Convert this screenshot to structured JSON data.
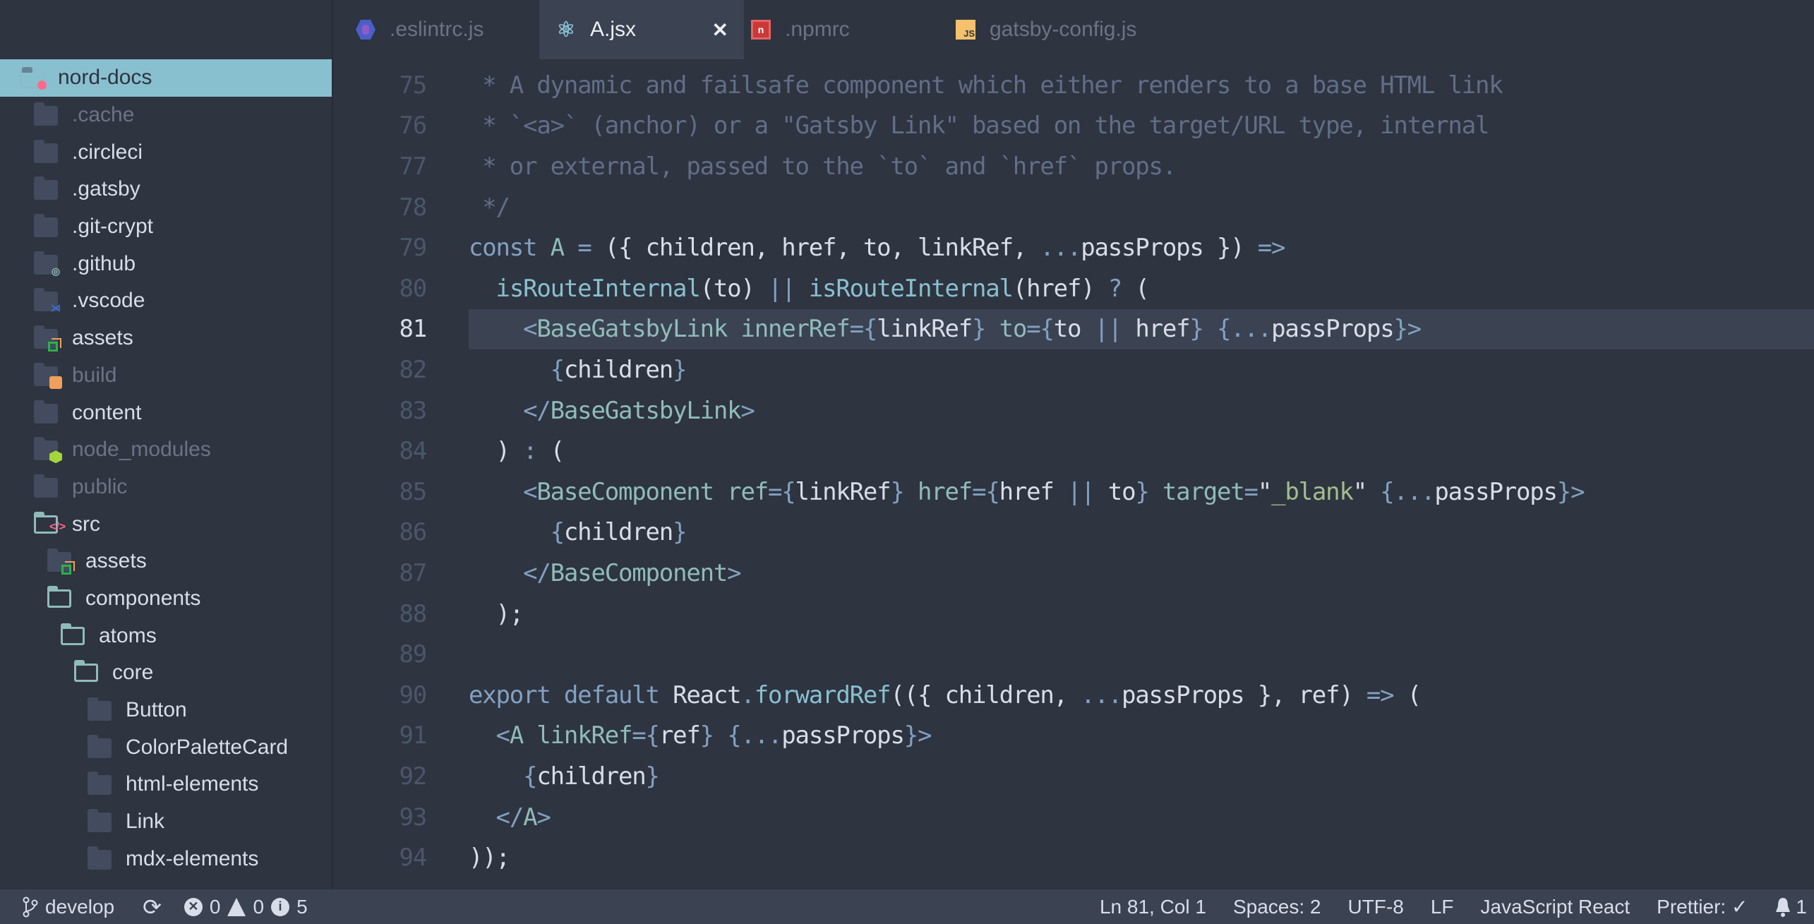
{
  "sidebar": {
    "items": [
      {
        "label": "nord-docs",
        "icon": "folder-root-icon",
        "depth": 0,
        "dim": false,
        "open": false,
        "selected": true
      },
      {
        "label": ".cache",
        "icon": "folder-icon",
        "depth": 1,
        "dim": true
      },
      {
        "label": ".circleci",
        "icon": "folder-icon",
        "depth": 1,
        "dim": false
      },
      {
        "label": ".gatsby",
        "icon": "folder-icon",
        "depth": 1,
        "dim": false
      },
      {
        "label": ".git-crypt",
        "icon": "folder-icon",
        "depth": 1,
        "dim": false
      },
      {
        "label": ".github",
        "icon": "folder-github-icon",
        "depth": 1,
        "dim": false
      },
      {
        "label": ".vscode",
        "icon": "folder-vscode-icon",
        "depth": 1,
        "dim": false
      },
      {
        "label": "assets",
        "icon": "folder-assets-icon",
        "depth": 1,
        "dim": false
      },
      {
        "label": "build",
        "icon": "folder-build-icon",
        "depth": 1,
        "dim": true
      },
      {
        "label": "content",
        "icon": "folder-icon",
        "depth": 1,
        "dim": false
      },
      {
        "label": "node_modules",
        "icon": "folder-node-icon",
        "depth": 1,
        "dim": true
      },
      {
        "label": "public",
        "icon": "folder-icon",
        "depth": 1,
        "dim": true
      },
      {
        "label": "src",
        "icon": "folder-src-open-icon",
        "depth": 1,
        "dim": false,
        "open": true
      },
      {
        "label": "assets",
        "icon": "folder-assets-icon",
        "depth": 2,
        "dim": false
      },
      {
        "label": "components",
        "icon": "folder-open-icon",
        "depth": 2,
        "dim": false,
        "open": true
      },
      {
        "label": "atoms",
        "icon": "folder-open-icon",
        "depth": 3,
        "dim": false,
        "open": true
      },
      {
        "label": "core",
        "icon": "folder-open-icon",
        "depth": 4,
        "dim": false,
        "open": true
      },
      {
        "label": "Button",
        "icon": "folder-icon",
        "depth": 5,
        "dim": false
      },
      {
        "label": "ColorPaletteCard",
        "icon": "folder-icon",
        "depth": 5,
        "dim": false
      },
      {
        "label": "html-elements",
        "icon": "folder-icon",
        "depth": 5,
        "dim": false
      },
      {
        "label": "Link",
        "icon": "folder-icon",
        "depth": 5,
        "dim": false
      },
      {
        "label": "mdx-elements",
        "icon": "folder-icon",
        "depth": 5,
        "dim": false
      }
    ]
  },
  "tabs": [
    {
      "label": ".eslintrc.js",
      "icon": "eslint-icon",
      "active": false
    },
    {
      "label": "A.jsx",
      "icon": "react-icon",
      "active": true
    },
    {
      "label": ".npmrc",
      "icon": "npm-icon",
      "active": false
    },
    {
      "label": "gatsby-config.js",
      "icon": "js-icon",
      "active": false
    }
  ],
  "editor": {
    "current_line": 81,
    "lines": [
      {
        "n": "75",
        "tokens": [
          [
            " * A dynamic and failsafe component which either renders to a base HTML link",
            "comment"
          ]
        ]
      },
      {
        "n": "76",
        "tokens": [
          [
            " * `<a>` (anchor) or a \"Gatsby Link\" based on the target/URL type, internal",
            "comment"
          ]
        ]
      },
      {
        "n": "77",
        "tokens": [
          [
            " * or external, passed to the `to` and `href` props.",
            "comment"
          ]
        ]
      },
      {
        "n": "78",
        "tokens": [
          [
            " */",
            "comment"
          ]
        ]
      },
      {
        "n": "79",
        "tokens": [
          [
            "const",
            "keyword"
          ],
          [
            " ",
            "plain"
          ],
          [
            "A",
            "tag"
          ],
          [
            " ",
            "plain"
          ],
          [
            "=",
            "op"
          ],
          [
            " ({ children, href, to, linkRef, ",
            "plain"
          ],
          [
            "...",
            "op"
          ],
          [
            "passProps }) ",
            "plain"
          ],
          [
            "=>",
            "op"
          ]
        ]
      },
      {
        "n": "80",
        "tokens": [
          [
            "  ",
            "plain"
          ],
          [
            "isRouteInternal",
            "func"
          ],
          [
            "(to) ",
            "plain"
          ],
          [
            "||",
            "op"
          ],
          [
            " ",
            "plain"
          ],
          [
            "isRouteInternal",
            "func"
          ],
          [
            "(href) ",
            "plain"
          ],
          [
            "?",
            "op"
          ],
          [
            " (",
            "plain"
          ]
        ]
      },
      {
        "n": "81",
        "tokens": [
          [
            "    ",
            "plain"
          ],
          [
            "<",
            "punct"
          ],
          [
            "BaseGatsbyLink",
            "tag"
          ],
          [
            " ",
            "plain"
          ],
          [
            "innerRef",
            "attr"
          ],
          [
            "={",
            "brace"
          ],
          [
            "linkRef",
            "plain"
          ],
          [
            "}",
            "brace"
          ],
          [
            " ",
            "plain"
          ],
          [
            "to",
            "attr"
          ],
          [
            "={",
            "brace"
          ],
          [
            "to ",
            "plain"
          ],
          [
            "||",
            "op"
          ],
          [
            " href",
            "plain"
          ],
          [
            "}",
            "brace"
          ],
          [
            " {...",
            "brace"
          ],
          [
            "passProps",
            "plain"
          ],
          [
            "}>",
            "brace"
          ]
        ]
      },
      {
        "n": "82",
        "tokens": [
          [
            "      ",
            "plain"
          ],
          [
            "{",
            "brace"
          ],
          [
            "children",
            "plain"
          ],
          [
            "}",
            "brace"
          ]
        ]
      },
      {
        "n": "83",
        "tokens": [
          [
            "    ",
            "plain"
          ],
          [
            "</",
            "punct"
          ],
          [
            "BaseGatsbyLink",
            "tag"
          ],
          [
            ">",
            "punct"
          ]
        ]
      },
      {
        "n": "84",
        "tokens": [
          [
            "  ) ",
            "plain"
          ],
          [
            ":",
            "op"
          ],
          [
            " (",
            "plain"
          ]
        ]
      },
      {
        "n": "85",
        "tokens": [
          [
            "    ",
            "plain"
          ],
          [
            "<",
            "punct"
          ],
          [
            "BaseComponent",
            "tag"
          ],
          [
            " ",
            "plain"
          ],
          [
            "ref",
            "attr"
          ],
          [
            "={",
            "brace"
          ],
          [
            "linkRef",
            "plain"
          ],
          [
            "}",
            "brace"
          ],
          [
            " ",
            "plain"
          ],
          [
            "href",
            "attr"
          ],
          [
            "={",
            "brace"
          ],
          [
            "href ",
            "plain"
          ],
          [
            "||",
            "op"
          ],
          [
            " to",
            "plain"
          ],
          [
            "}",
            "brace"
          ],
          [
            " ",
            "plain"
          ],
          [
            "target",
            "attr"
          ],
          [
            "=",
            "brace"
          ],
          [
            "\"",
            "plain"
          ],
          [
            "_blank",
            "string"
          ],
          [
            "\"",
            "plain"
          ],
          [
            " {...",
            "brace"
          ],
          [
            "passProps",
            "plain"
          ],
          [
            "}>",
            "brace"
          ]
        ]
      },
      {
        "n": "86",
        "tokens": [
          [
            "      ",
            "plain"
          ],
          [
            "{",
            "brace"
          ],
          [
            "children",
            "plain"
          ],
          [
            "}",
            "brace"
          ]
        ]
      },
      {
        "n": "87",
        "tokens": [
          [
            "    ",
            "plain"
          ],
          [
            "</",
            "punct"
          ],
          [
            "BaseComponent",
            "tag"
          ],
          [
            ">",
            "punct"
          ]
        ]
      },
      {
        "n": "88",
        "tokens": [
          [
            "  );",
            "plain"
          ]
        ]
      },
      {
        "n": "89",
        "tokens": []
      },
      {
        "n": "90",
        "tokens": [
          [
            "export",
            "keyword"
          ],
          [
            " ",
            "plain"
          ],
          [
            "default",
            "keyword"
          ],
          [
            " React",
            "plain"
          ],
          [
            ".",
            "op"
          ],
          [
            "forwardRef",
            "func"
          ],
          [
            "(({ children, ",
            "plain"
          ],
          [
            "...",
            "op"
          ],
          [
            "passProps }, ref) ",
            "plain"
          ],
          [
            "=>",
            "op"
          ],
          [
            " (",
            "plain"
          ]
        ]
      },
      {
        "n": "91",
        "tokens": [
          [
            "  ",
            "plain"
          ],
          [
            "<",
            "punct"
          ],
          [
            "A",
            "tag"
          ],
          [
            " ",
            "plain"
          ],
          [
            "linkRef",
            "attr"
          ],
          [
            "={",
            "brace"
          ],
          [
            "ref",
            "plain"
          ],
          [
            "}",
            "brace"
          ],
          [
            " {...",
            "brace"
          ],
          [
            "passProps",
            "plain"
          ],
          [
            "}>",
            "brace"
          ]
        ]
      },
      {
        "n": "92",
        "tokens": [
          [
            "    ",
            "plain"
          ],
          [
            "{",
            "brace"
          ],
          [
            "children",
            "plain"
          ],
          [
            "}",
            "brace"
          ]
        ]
      },
      {
        "n": "93",
        "tokens": [
          [
            "  ",
            "plain"
          ],
          [
            "</",
            "punct"
          ],
          [
            "A",
            "tag"
          ],
          [
            ">",
            "punct"
          ]
        ]
      },
      {
        "n": "94",
        "tokens": [
          [
            "));",
            "plain"
          ]
        ]
      }
    ]
  },
  "statusbar": {
    "branch": "develop",
    "branch_icon": "git-branch-icon",
    "sync_icon": "sync-icon",
    "errors": "0",
    "warnings": "0",
    "infos": "5",
    "position": "Ln 81, Col 1",
    "indent": "Spaces: 2",
    "encoding": "UTF-8",
    "eol": "LF",
    "language": "JavaScript React",
    "prettier": "Prettier: ✓",
    "notifications": "1"
  },
  "colors": {
    "background": "#2e3440",
    "accent": "#88c0d0",
    "current_line": "#3b4252"
  }
}
